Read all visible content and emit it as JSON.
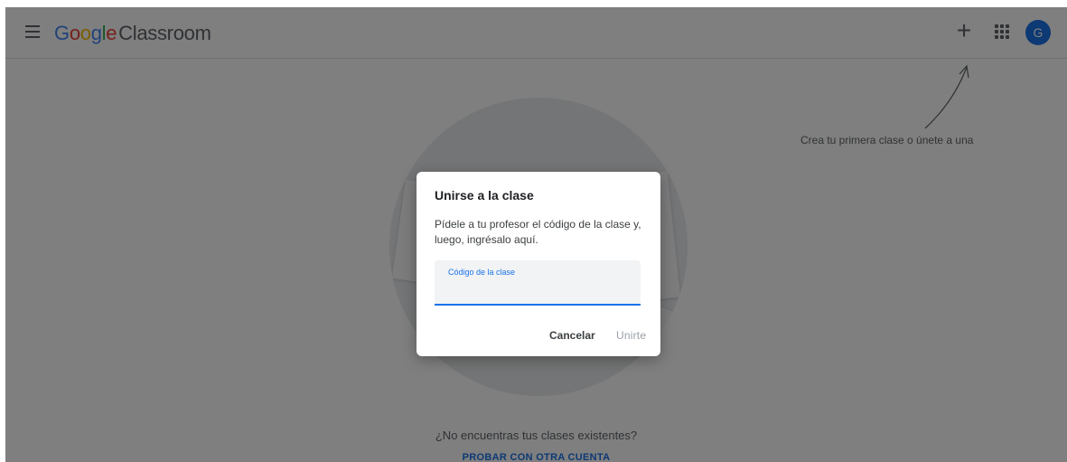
{
  "header": {
    "logo_google": [
      "G",
      "o",
      "o",
      "g",
      "l",
      "e"
    ],
    "logo_app": "Classroom",
    "plus_label": "+",
    "avatar_initial": "G",
    "icons": {
      "menu": "menu-icon",
      "plus": "plus-icon",
      "apps": "apps-grid-icon"
    }
  },
  "empty_state": {
    "hint": "Crea tu primera clase o únete a una",
    "not_found": "¿No encuentras tus clases existentes?",
    "try_account": "PROBAR CON OTRA CUENTA"
  },
  "dialog": {
    "title": "Unirse a la clase",
    "description": "Pídele a tu profesor el código de la clase y, luego, ingrésalo aquí.",
    "field_label": "Código de la clase",
    "field_value": "",
    "cancel_label": "Cancelar",
    "join_label": "Unirte"
  },
  "colors": {
    "accent": "#1a73e8",
    "scrim": "rgba(0,0,0,0.5)",
    "google_blue": "#4285f4",
    "google_red": "#ea4335",
    "google_yellow": "#fbbc05",
    "google_green": "#34a853"
  }
}
